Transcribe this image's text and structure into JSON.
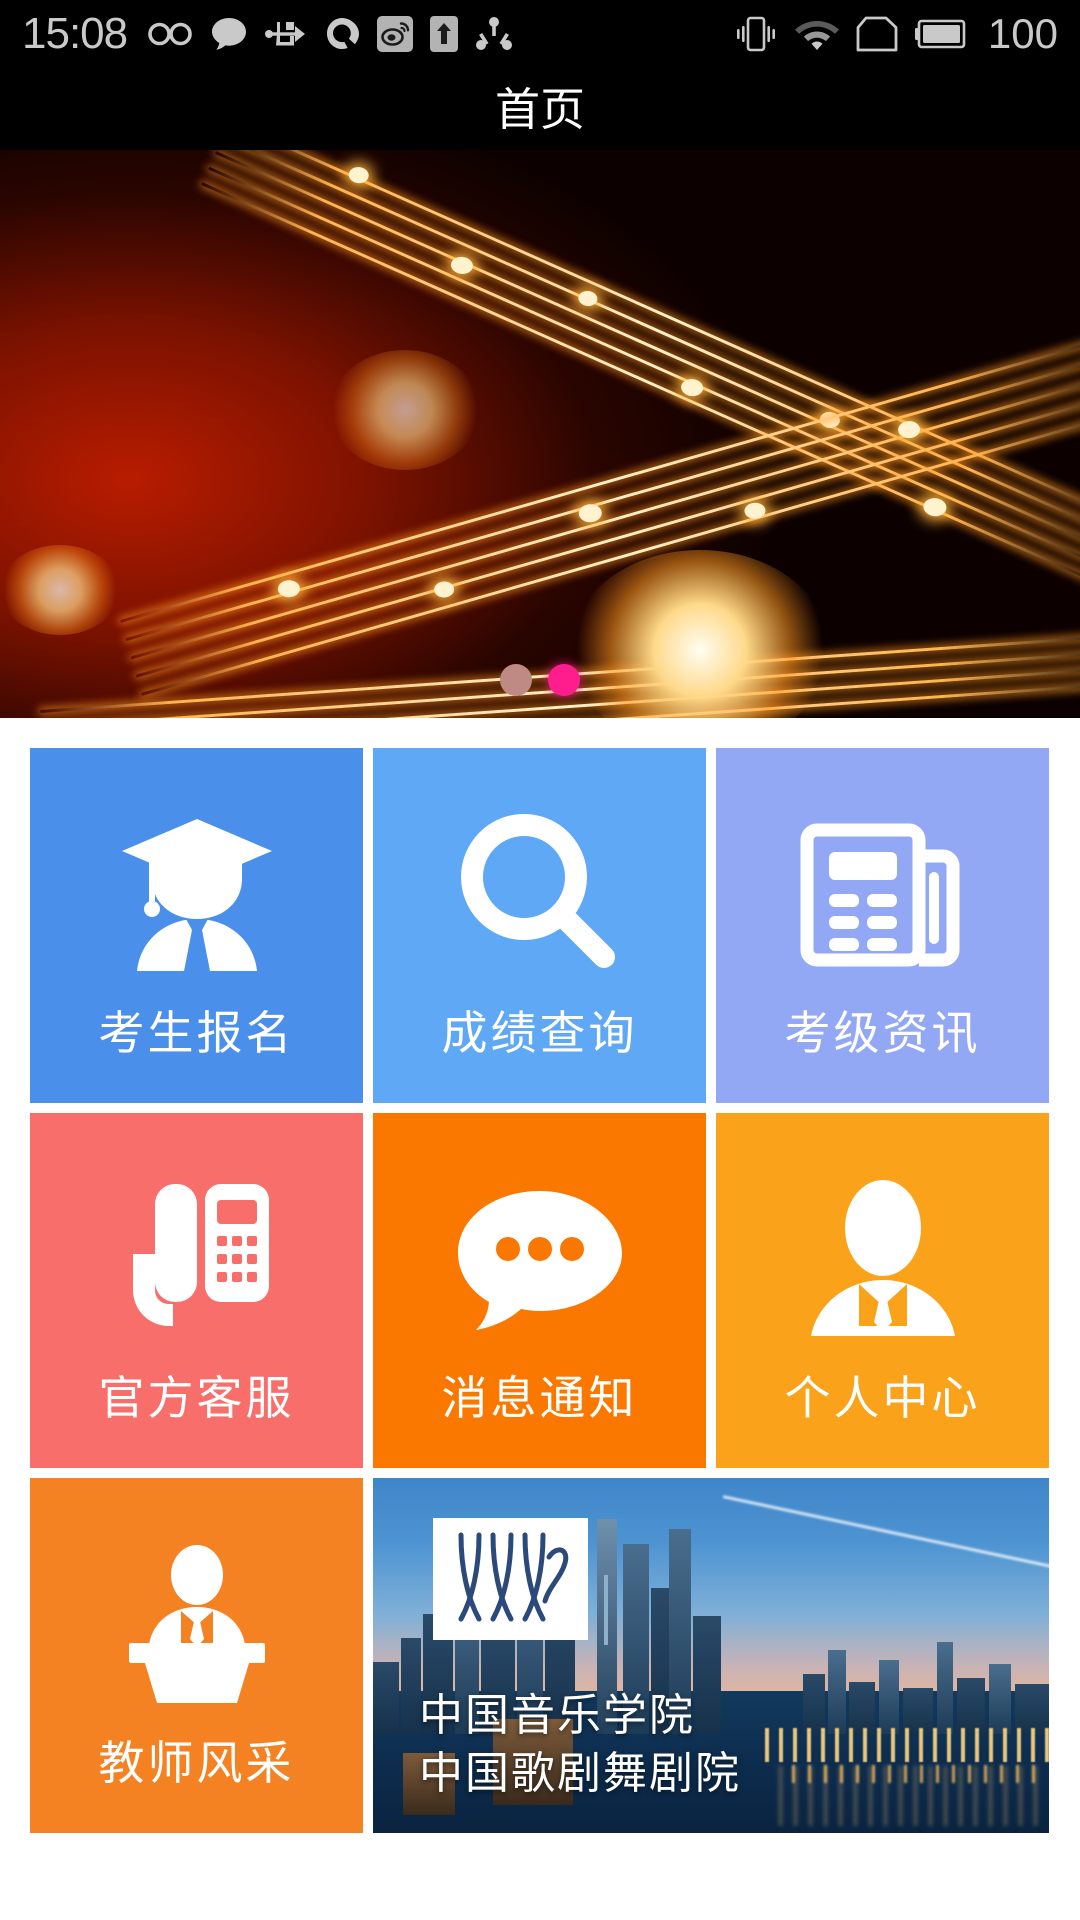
{
  "status_bar": {
    "clock": "15:08",
    "battery_level": "100",
    "left_icons": [
      "infinity-icon",
      "message-bubble-icon",
      "usb-icon",
      "qq-icon",
      "weibo-icon",
      "upload-arrow-icon",
      "share-nodes-icon"
    ],
    "right_icons": [
      "vibrate-icon",
      "wifi-icon",
      "sim-card-icon",
      "battery-icon"
    ]
  },
  "title_bar": {
    "title": "首页"
  },
  "banner": {
    "alt": "music-notes-banner",
    "dots": [
      {
        "name": "carousel-dot-1",
        "active": false,
        "color": "#c08a84"
      },
      {
        "name": "carousel-dot-2",
        "active": true,
        "color": "#ff1d8e"
      }
    ]
  },
  "grid": {
    "rows": [
      {
        "tiles": [
          {
            "label": "考生报名",
            "icon": "graduate-student-icon",
            "color": "#4a90ea"
          },
          {
            "label": "成绩查询",
            "icon": "magnifier-icon",
            "color": "#5fa8f5"
          },
          {
            "label": "考级资讯",
            "icon": "newspaper-icon",
            "color": "#92a8f5"
          }
        ]
      },
      {
        "tiles": [
          {
            "label": "官方客服",
            "icon": "telephone-icon",
            "color": "#f86e6a"
          },
          {
            "label": "消息通知",
            "icon": "chat-bubble-icon",
            "color": "#fa7800"
          },
          {
            "label": "个人中心",
            "icon": "user-suit-icon",
            "color": "#faa21a"
          }
        ]
      },
      {
        "tiles": [
          {
            "label": "教师风采",
            "icon": "lecturer-podium-icon",
            "color": "#f58222"
          }
        ]
      }
    ],
    "photo_tile": {
      "name": "conservatory-banner-tile",
      "logo": "conservatory-logo",
      "line1": "中国音乐学院",
      "line2": "中国歌剧舞剧院"
    }
  }
}
